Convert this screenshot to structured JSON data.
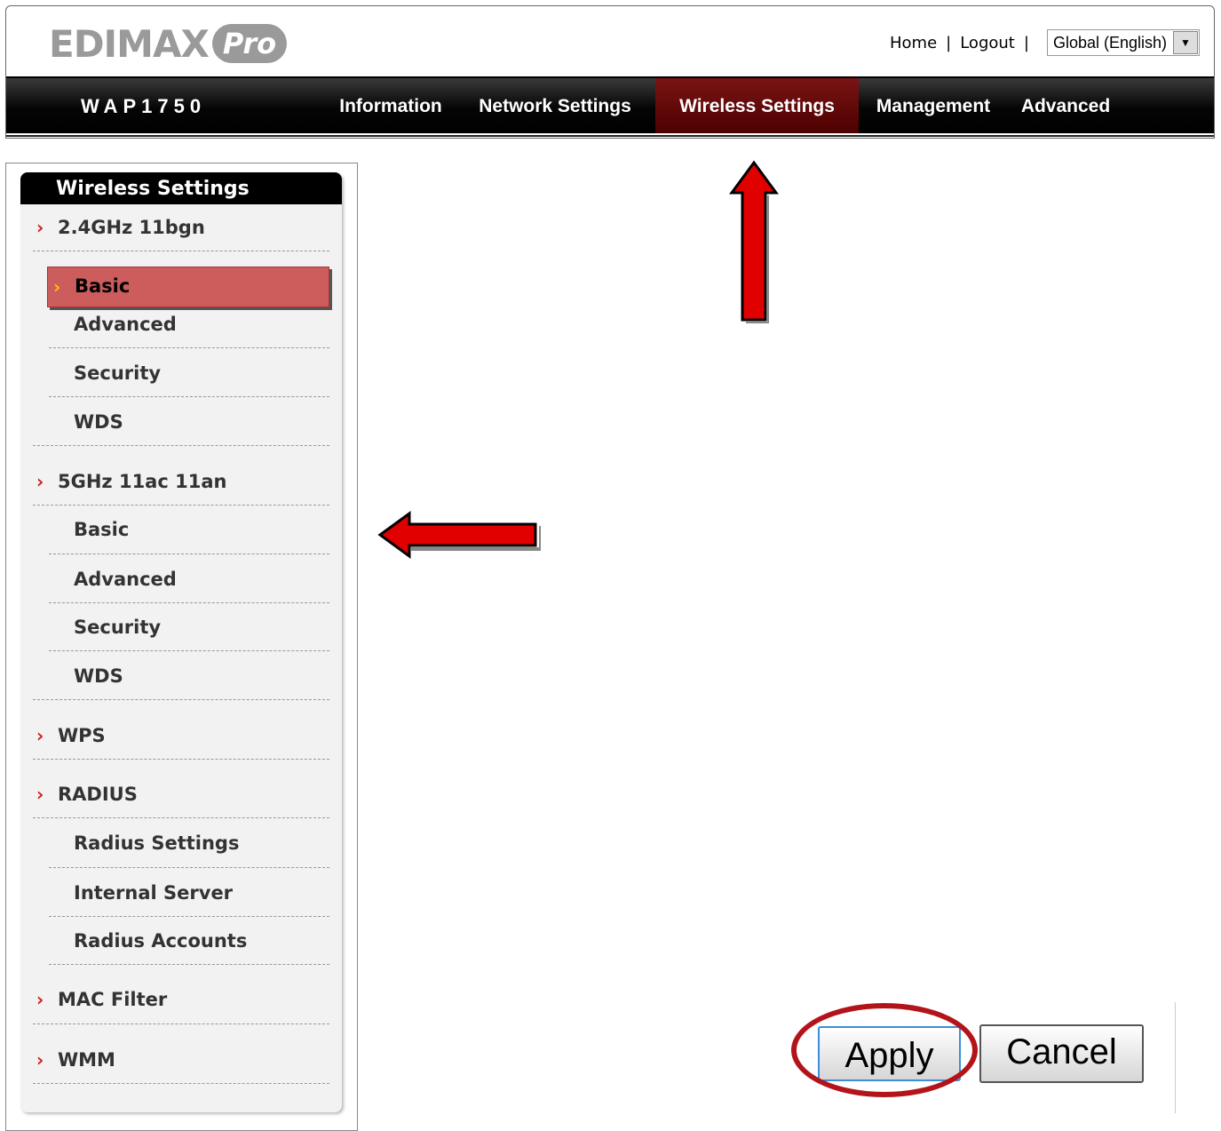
{
  "header": {
    "logo": {
      "brand": "EDIMAX",
      "suffix": "Pro"
    },
    "links": {
      "home": "Home",
      "logout": "Logout",
      "sep": "|"
    },
    "language": {
      "selected": "Global (English)"
    }
  },
  "navbar": {
    "model": "WAP1750",
    "tabs": [
      {
        "label": "Information"
      },
      {
        "label": "Network Settings"
      },
      {
        "label": "Wireless Settings"
      },
      {
        "label": "Management"
      },
      {
        "label": "Advanced"
      }
    ],
    "active_tab": "Wireless Settings"
  },
  "sidebar": {
    "title": "Wireless Settings",
    "items": [
      {
        "label": "2.4GHz 11bgn",
        "type": "section"
      },
      {
        "label": "Basic",
        "type": "sub",
        "active": true
      },
      {
        "label": "Advanced",
        "type": "sub"
      },
      {
        "label": "Security",
        "type": "sub"
      },
      {
        "label": "WDS",
        "type": "sub"
      },
      {
        "label": "5GHz 11ac 11an",
        "type": "section"
      },
      {
        "label": "Basic",
        "type": "sub"
      },
      {
        "label": "Advanced",
        "type": "sub"
      },
      {
        "label": "Security",
        "type": "sub"
      },
      {
        "label": "WDS",
        "type": "sub"
      },
      {
        "label": "WPS",
        "type": "section"
      },
      {
        "label": "RADIUS",
        "type": "section"
      },
      {
        "label": "Radius Settings",
        "type": "sub"
      },
      {
        "label": "Internal Server",
        "type": "sub"
      },
      {
        "label": "Radius Accounts",
        "type": "sub"
      },
      {
        "label": "MAC Filter",
        "type": "section"
      },
      {
        "label": "WMM",
        "type": "section"
      }
    ]
  },
  "buttons": {
    "apply": "Apply",
    "cancel": "Cancel"
  },
  "colors": {
    "accent": "#cc1f1f",
    "active_tab": "#6a0f0f",
    "highlight": "#cd5c5c",
    "annotation": "#b3141a"
  },
  "icons": {
    "chevron": "chevron-right-icon",
    "dropdown": "dropdown-arrow-icon",
    "annotation_arrow": "red-arrow-icon"
  }
}
